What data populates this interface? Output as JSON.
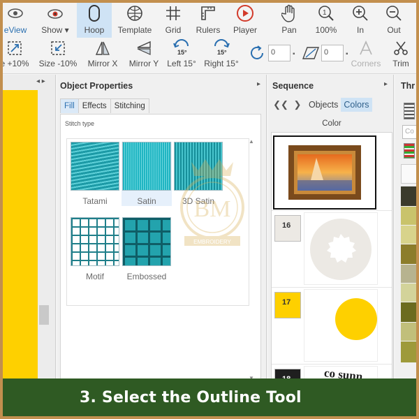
{
  "toolbar_row1": [
    {
      "id": "preview",
      "label": "eView",
      "icon": "eye-icon"
    },
    {
      "id": "show",
      "label": "Show",
      "icon": "eye-color-icon"
    },
    {
      "id": "hoop",
      "label": "Hoop",
      "icon": "hoop-icon"
    },
    {
      "id": "template",
      "label": "Template",
      "icon": "template-globe-icon"
    },
    {
      "id": "grid",
      "label": "Grid",
      "icon": "grid-icon"
    },
    {
      "id": "rulers",
      "label": "Rulers",
      "icon": "rulers-icon"
    },
    {
      "id": "player",
      "label": "Player",
      "icon": "play-icon"
    },
    {
      "id": "pan",
      "label": "Pan",
      "icon": "hand-icon"
    },
    {
      "id": "zoom100",
      "label": "100%",
      "icon": "zoom-1-icon"
    },
    {
      "id": "zoomin",
      "label": "In",
      "icon": "zoom-in-icon"
    },
    {
      "id": "zoomout",
      "label": "Out",
      "icon": "zoom-out-icon"
    }
  ],
  "toolbar_row2": [
    {
      "id": "size_up",
      "label": "e +10%",
      "icon": "size-up-icon"
    },
    {
      "id": "size_down",
      "label": "Size -10%",
      "icon": "size-down-icon"
    },
    {
      "id": "mirror_x",
      "label": "Mirror X",
      "icon": "mirror-x-icon"
    },
    {
      "id": "mirror_y",
      "label": "Mirror Y",
      "icon": "mirror-y-icon"
    },
    {
      "id": "left15",
      "label": "Left 15°",
      "icon": "rotate-left-icon",
      "badge": "15°"
    },
    {
      "id": "right15",
      "label": "Right 15°",
      "icon": "rotate-right-icon",
      "badge": "15°"
    },
    {
      "id": "corners",
      "label": "Corners",
      "icon": "corners-icon"
    },
    {
      "id": "trim",
      "label": "Trim",
      "icon": "scissors-icon"
    }
  ],
  "rotate_value": "0",
  "skew_value": "0",
  "object_properties": {
    "title": "Object Properties",
    "tabs": [
      "Fill",
      "Effects",
      "Stitching"
    ],
    "active_tab": "Fill",
    "stitch_type_label": "Stitch type",
    "stitches": [
      {
        "name": "Tatami",
        "color": "#1aa6b3"
      },
      {
        "name": "Satin",
        "color": "#1fb5c2"
      },
      {
        "name": "3D Satin",
        "color": "#1aa6b3"
      },
      {
        "name": "Motif",
        "color": "#1f7f8a"
      },
      {
        "name": "Embossed",
        "color": "#23a3ad"
      }
    ],
    "selected_stitch": "Satin"
  },
  "sequence": {
    "title": "Sequence",
    "tabs": [
      "Objects",
      "Colors"
    ],
    "active_tab": "Colors",
    "column": "Color",
    "rows": [
      {
        "number": "",
        "color": "#ffffff"
      },
      {
        "number": "16",
        "color": "#ece9e4"
      },
      {
        "number": "17",
        "color": "#fed000"
      },
      {
        "number": "18",
        "color": "#1f1f1f"
      }
    ],
    "partial_text": "co sunn"
  },
  "threads": {
    "title": "Thr",
    "search_placeholder": "Co",
    "swatches": [
      "#3b3b2c",
      "#c9c36b",
      "#d8d38b",
      "#8c7d2b",
      "#b7b38f",
      "#d3d39a",
      "#6b6b1f",
      "#c1bf7a",
      "#9e9a3a"
    ]
  },
  "watermark": {
    "monogram": "BM",
    "ribbon": "EMBROIDERY"
  },
  "caption": "3. Select the Outline Tool",
  "colors": {
    "accent_hover": "#cfe3f5",
    "caption_bg": "#2f5a23",
    "border": "#c28f4e",
    "yellow": "#fed000"
  }
}
